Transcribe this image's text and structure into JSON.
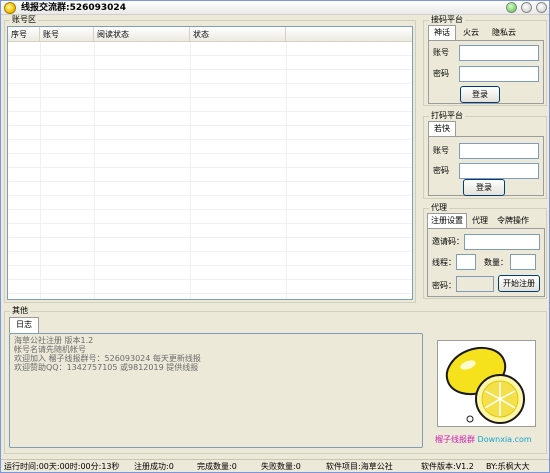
{
  "window": {
    "title": "线报交流群:526093024"
  },
  "account_area": {
    "label": "账号区",
    "columns": [
      "序号",
      "账号",
      "阅读状态",
      "状态"
    ]
  },
  "receive_platform": {
    "label": "接码平台",
    "tabs": [
      "神话",
      "火云",
      "隐私云"
    ],
    "active_tab": "神话",
    "account_label": "账号",
    "password_label": "密码",
    "account_value": "",
    "password_value": "",
    "login_label": "登录"
  },
  "captcha_platform": {
    "label": "打码平台",
    "tabs": [
      "若快"
    ],
    "account_label": "账号",
    "password_label": "密码",
    "account_value": "",
    "password_value": "",
    "login_label": "登录"
  },
  "proxy": {
    "label": "代理",
    "tabs": [
      "注册设置",
      "代理",
      "令牌操作"
    ],
    "invite_code_label": "邀请码：",
    "threads_label": "线程：",
    "quantity_label": "数量：",
    "password_label": "密码：",
    "invite_code_value": "",
    "threads_value": "",
    "quantity_value": "",
    "password_value": "",
    "start_label": "开始注册"
  },
  "other": {
    "label": "其他",
    "tabs": [
      "日志"
    ],
    "log_lines": [
      "海草公社注册  版本1.2",
      "帐号名请先随机帐号",
      "欢迎加入   榴子线报群号：526093024  每天更新线报",
      "欢迎赞助QQ：1342757105  或9812019  提供线报"
    ]
  },
  "watermark": {
    "text_left": "榴子线报群",
    "text_right": "Downxia.com"
  },
  "statusbar": {
    "runtime": "运行时间:00天:00时:00分:13秒",
    "registered": "注册成功:0",
    "completed": "完成数量:0",
    "failed": "失败数量:0",
    "project": "软件项目:海草公社",
    "version": "软件版本:V1.2",
    "author": "BY:乐枫大大"
  },
  "colors": {
    "accent": "#7a96df",
    "lemon": "#f6e21c",
    "watermark": "#d01fb0"
  }
}
